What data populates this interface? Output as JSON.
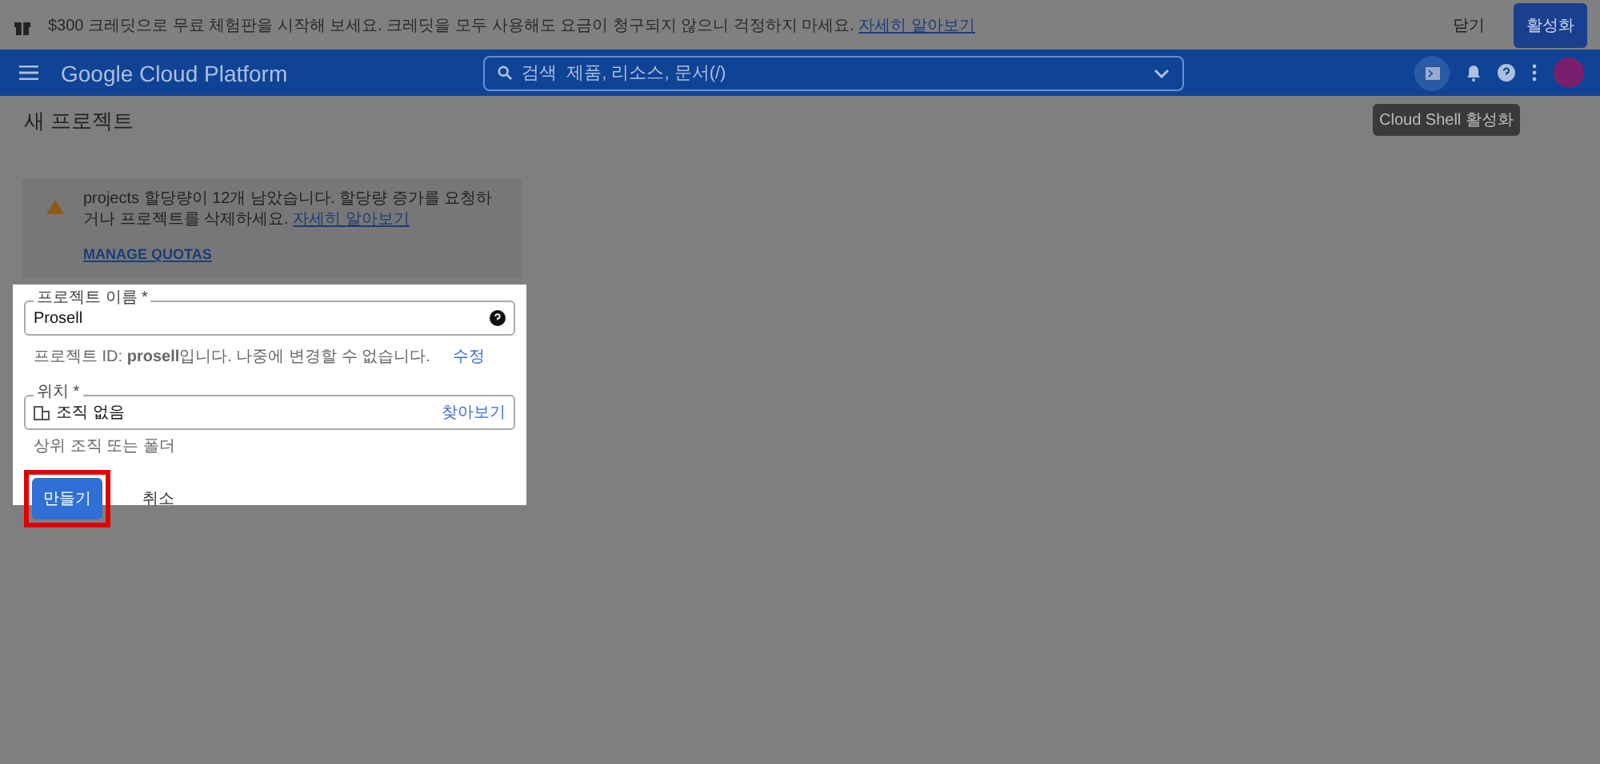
{
  "banner": {
    "text": "$300 크레딧으로 무료 체험판을 시작해 보세요. 크레딧을 모두 사용해도 요금이 청구되지 않으니 걱정하지 마세요.",
    "link": "자세히 알아보기",
    "dismiss": "닫기",
    "activate": "활성화"
  },
  "header": {
    "title": "Google Cloud Platform",
    "search_placeholder": "검색  제품, 리소스, 문서(/)",
    "tooltip": "Cloud Shell 활성화"
  },
  "page_title": "새 프로젝트",
  "quota": {
    "text": "projects 할당량이 12개 남았습니다. 할당량 증가를 요청하거나 프로젝트를 삭제하세요.",
    "link": "자세히 알아보기",
    "action": "MANAGE QUOTAS"
  },
  "form": {
    "name_label": "프로젝트 이름 *",
    "name_value": "Prosell",
    "id_hint": "프로젝트 ID: **prosell**입니다. 나중에 변경할 수 없습니다.",
    "edit": "수정",
    "location_label": "위치 *",
    "location_value": "조직 없음",
    "browse": "찾아보기",
    "location_hint": "상위 조직 또는 폴더",
    "create": "만들기",
    "cancel": "취소",
    "create_highlighted": true
  }
}
